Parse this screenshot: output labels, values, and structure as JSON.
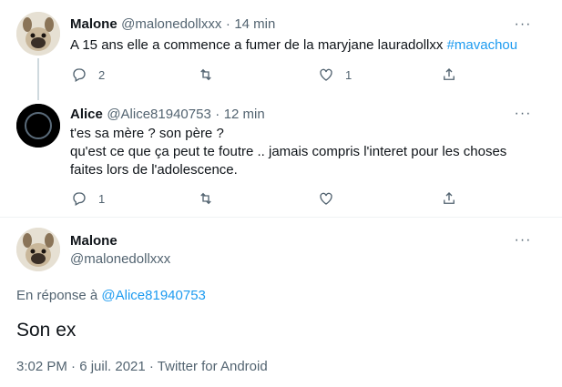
{
  "tweet1": {
    "name": "Malone",
    "handle": "@malonedollxxx",
    "separator": "·",
    "time": "14 min",
    "text": "A 15 ans elle a commence a fumer de la maryjane lauradollxx ",
    "hashtag": "#mavachou",
    "reply_count": "2",
    "like_count": "1"
  },
  "tweet2": {
    "name": "Alice",
    "handle": "@Alice81940753",
    "separator": "·",
    "time": "12 min",
    "line1": "t'es sa mère ? son père ?",
    "line2": "qu'est ce que ça peut te foutre .. jamais compris l'interet pour les choses",
    "line3": "faites lors de l'adolescence.",
    "reply_count": "1"
  },
  "main": {
    "name": "Malone",
    "handle": "@malonedollxxx",
    "reply_prefix": "En réponse à ",
    "reply_to": "@Alice81940753",
    "text": "Son ex",
    "timestamp": "3:02 PM · 6 juil. 2021 · Twitter for Android"
  },
  "colors": {
    "accent": "#1d9bf0",
    "secondary_text": "#536471",
    "thread_line": "#cfd9de"
  },
  "icons": [
    "reply-icon",
    "retweet-icon",
    "like-icon",
    "share-icon",
    "more-icon"
  ]
}
